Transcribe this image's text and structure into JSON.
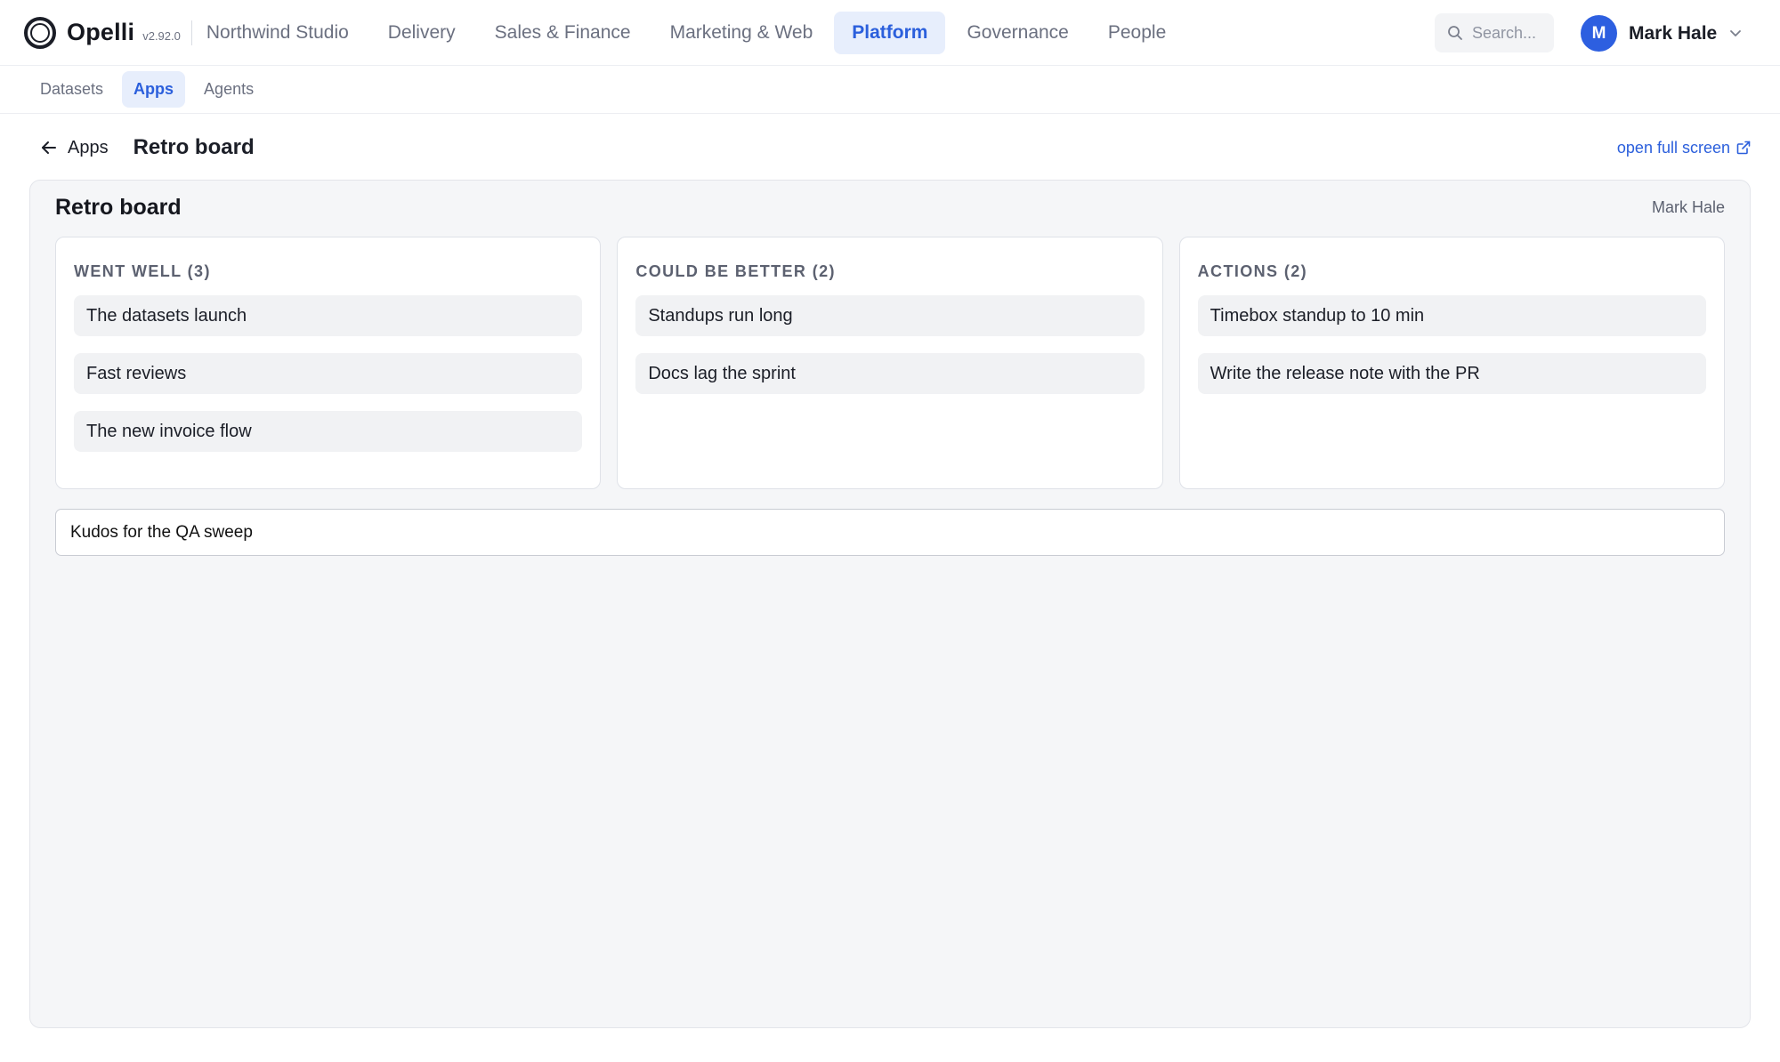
{
  "app": {
    "name": "Opelli",
    "version": "v2.92.0",
    "org": "Northwind Studio"
  },
  "nav": [
    "Delivery",
    "Sales & Finance",
    "Marketing & Web",
    "Platform",
    "Governance",
    "People"
  ],
  "nav_active": "Platform",
  "search": {
    "placeholder": "Search..."
  },
  "user": {
    "initial": "M",
    "name": "Mark Hale"
  },
  "subnav": [
    "Datasets",
    "Apps",
    "Agents"
  ],
  "subnav_active": "Apps",
  "page": {
    "back_label": "Apps",
    "title": "Retro board",
    "full_screen_label": "open full screen"
  },
  "board": {
    "title": "Retro board",
    "user": "Mark Hale",
    "columns": [
      {
        "title": "WENT WELL (3)",
        "cards": [
          "The datasets launch",
          "Fast reviews",
          "The new invoice flow"
        ]
      },
      {
        "title": "COULD BE BETTER (2)",
        "cards": [
          "Standups run long",
          "Docs lag the sprint"
        ]
      },
      {
        "title": "ACTIONS (2)",
        "cards": [
          "Timebox standup to 10 min",
          "Write the release note with the PR"
        ]
      }
    ],
    "new_card_value": "Kudos for the QA sweep"
  },
  "colors": {
    "accent": "#2b5fdc",
    "accent_bg": "#e7eefc",
    "avatar": "#2d5fe0"
  }
}
